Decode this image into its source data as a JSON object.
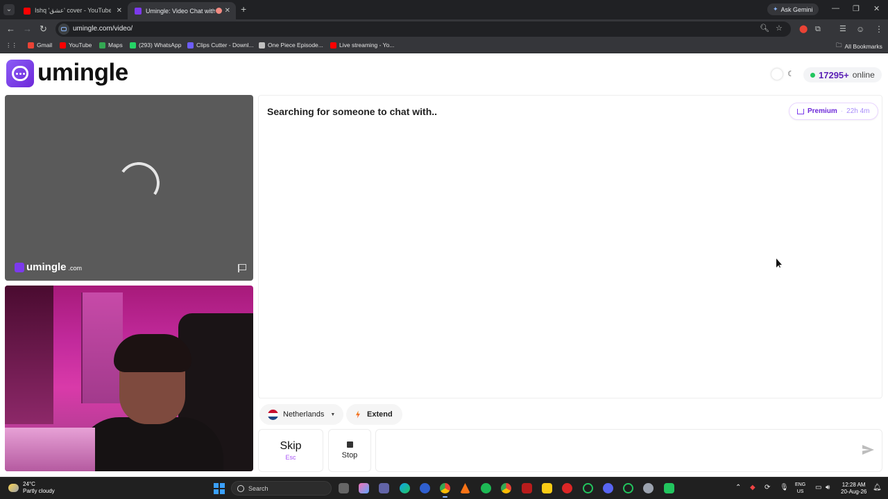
{
  "browser": {
    "tabs": [
      {
        "title": "Ishq 'عشق' cover - YouTube",
        "favicon_color": "#ff0000"
      },
      {
        "title": "Umingle: Video Chat with St",
        "favicon_color": "#7c3aed"
      }
    ],
    "new_tab": "+",
    "gemini_label": "Ask Gemini",
    "url": "umingle.com/video/",
    "bookmarks": [
      {
        "label": "Gmail",
        "color": "#ea4335"
      },
      {
        "label": "YouTube",
        "color": "#ff0000"
      },
      {
        "label": "Maps",
        "color": "#34a853"
      },
      {
        "label": "(293) WhatsApp",
        "color": "#25d366"
      },
      {
        "label": "Clips Cutter - Downl...",
        "color": "#6d5dfc"
      },
      {
        "label": "One Piece Episode...",
        "color": "#c0c0c0"
      },
      {
        "label": "Live streaming - Yo...",
        "color": "#ff0000"
      }
    ],
    "all_bookmarks": "All Bookmarks"
  },
  "site": {
    "logo_text": "umingle",
    "online_count": "17295+",
    "online_label": "online",
    "watermark_name": "umingle",
    "watermark_tld": ".com",
    "status": "Searching for someone to chat with..",
    "premium_label": "Premium",
    "premium_sep": "·",
    "premium_time": "22h 4m",
    "country": "Netherlands",
    "extend_label": "Extend",
    "skip_label": "Skip",
    "skip_hint": "Esc",
    "stop_label": "Stop",
    "message_value": "",
    "accent_color": "#7c3aed"
  },
  "taskbar": {
    "temperature": "24°C",
    "weather": "Partly cloudy",
    "search_placeholder": "Search",
    "lang_top": "ENG",
    "lang_bottom": "US",
    "time": "12:28 AM",
    "date": "20-Aug-26"
  }
}
